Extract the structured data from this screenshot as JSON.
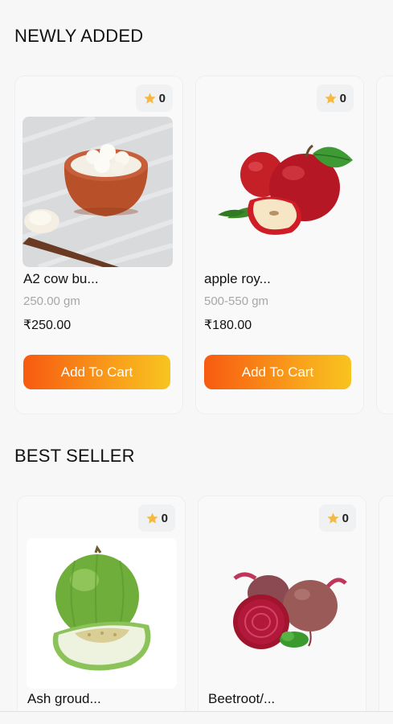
{
  "sections": [
    {
      "title": "NEWLY ADDED",
      "products": [
        {
          "rating": "0",
          "name": "A2 cow bu...",
          "quantity": "250.00 gm",
          "price": "₹250.00",
          "button_label": "Add To Cart",
          "image": "butter-in-clay-pot"
        },
        {
          "rating": "0",
          "name": "apple roy...",
          "quantity": "500-550 gm",
          "price": "₹180.00",
          "button_label": "Add To Cart",
          "image": "red-apples"
        }
      ]
    },
    {
      "title": "BEST SELLER",
      "products": [
        {
          "rating": "0",
          "name": "Ash groud...",
          "image": "ash-gourd"
        },
        {
          "rating": "0",
          "name": "Beetroot/...",
          "image": "beetroot"
        }
      ]
    }
  ],
  "colors": {
    "star": "#f5b942",
    "button_gradient_start": "#f75a10",
    "button_gradient_end": "#f7c41f"
  },
  "icons": {
    "rating": "star-icon"
  }
}
